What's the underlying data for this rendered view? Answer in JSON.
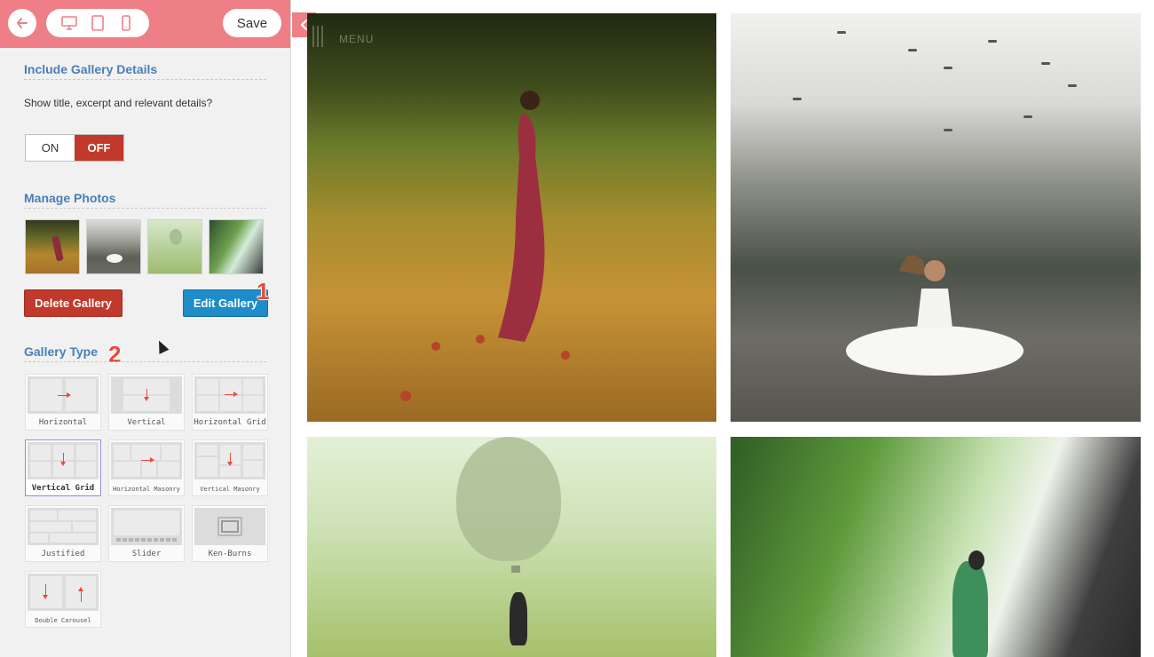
{
  "toolbar": {
    "save_label": "Save",
    "back_icon": "arrow-left-icon",
    "devices": [
      "desktop-icon",
      "tablet-icon",
      "mobile-icon"
    ]
  },
  "sections": {
    "gallery_details": {
      "title": "Include Gallery Details",
      "description": "Show title, excerpt and relevant details?",
      "toggle_on": "ON",
      "toggle_off": "OFF",
      "selected": "OFF"
    },
    "manage_photos": {
      "title": "Manage Photos",
      "delete_label": "Delete Gallery",
      "edit_label": "Edit Gallery"
    },
    "gallery_type": {
      "title": "Gallery Type",
      "selected": "Vertical Grid",
      "types": [
        "Horizontal",
        "Vertical",
        "Horizontal Grid",
        "Vertical Grid",
        "Horizontal Masonry",
        "Vertical Masonry",
        "Justified",
        "Slider",
        "Ken-Burns",
        "Double Carousel"
      ]
    }
  },
  "steps": [
    "1",
    "2"
  ],
  "gallery": {
    "menu_label": "MENU"
  },
  "colors": {
    "topbar": "#ee7f86",
    "section_title": "#4a7fb8",
    "delete": "#c0392b",
    "edit": "#1e8cc8",
    "step_number": "#e74c3c"
  }
}
